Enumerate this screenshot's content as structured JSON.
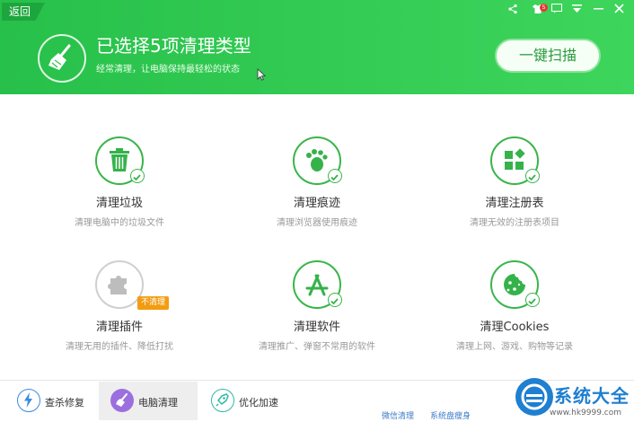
{
  "header": {
    "back_label": "返回",
    "title": "已选择5项清理类型",
    "subtitle": "经常清理，让电脑保持最轻松的状态",
    "scan_label": "一键扫描",
    "notification_count": "5",
    "accent": "#2fc850"
  },
  "window_controls": [
    {
      "icon": "share-icon",
      "glyph": "<"
    },
    {
      "icon": "skin-icon",
      "glyph": "👕"
    },
    {
      "icon": "message-icon",
      "glyph": "▭"
    },
    {
      "icon": "menu-icon",
      "glyph": "⊽"
    },
    {
      "icon": "minimize-icon",
      "glyph": "—"
    },
    {
      "icon": "close-icon",
      "glyph": "✕"
    }
  ],
  "items": [
    {
      "title": "清理垃圾",
      "desc": "清理电脑中的垃圾文件",
      "icon": "trash-icon",
      "selected": true
    },
    {
      "title": "清理痕迹",
      "desc": "清理浏览器使用痕迹",
      "icon": "footprint-icon",
      "selected": true
    },
    {
      "title": "清理注册表",
      "desc": "清理无效的注册表项目",
      "icon": "registry-icon",
      "selected": true
    },
    {
      "title": "清理插件",
      "desc": "清理无用的插件、降低打扰",
      "icon": "puzzle-icon",
      "selected": false,
      "tag": "不清理"
    },
    {
      "title": "清理软件",
      "desc": "清理推广、弹窗不常用的软件",
      "icon": "app-store-icon",
      "selected": true
    },
    {
      "title": "清理Cookies",
      "desc": "清理上网、游戏、购物等记录",
      "icon": "cookie-icon",
      "selected": true
    }
  ],
  "tabs": [
    {
      "label": "查杀修复",
      "icon": "lightning-icon",
      "active": false
    },
    {
      "label": "电脑清理",
      "icon": "broom-icon",
      "active": true
    },
    {
      "label": "优化加速",
      "icon": "rocket-icon",
      "active": false
    }
  ],
  "footer_links": {
    "wechat": "微信清理",
    "system": "系统盘瘦身"
  },
  "watermark": {
    "text": "系统大全",
    "url": "www.hk9999.com"
  }
}
